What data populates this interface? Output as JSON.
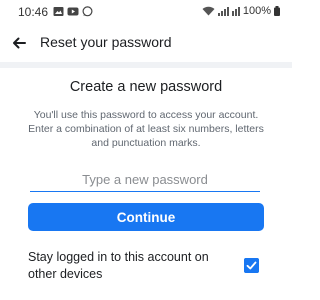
{
  "status_bar": {
    "time": "10:46",
    "battery": "100%",
    "left_icons": [
      "gallery-icon",
      "youtube-icon",
      "whatsapp-icon"
    ],
    "right_icons": [
      "wifi-icon",
      "signal-icon",
      "battery-icon"
    ]
  },
  "app_bar": {
    "title": "Reset your password",
    "back_icon": "arrow-left-icon"
  },
  "form": {
    "heading": "Create a new password",
    "description": "You'll use this password to access your account. Enter a combination of at least six numbers, letters and punctuation marks.",
    "password_placeholder": "Type a new password",
    "password_value": "",
    "continue_label": "Continue"
  },
  "stay_logged_in": {
    "label": "Stay logged in to this account on other devices",
    "checked": true
  },
  "colors": {
    "accent": "#1877f2",
    "text": "#1c1e21",
    "secondary_text": "#606770",
    "divider": "#f0f2f5"
  }
}
